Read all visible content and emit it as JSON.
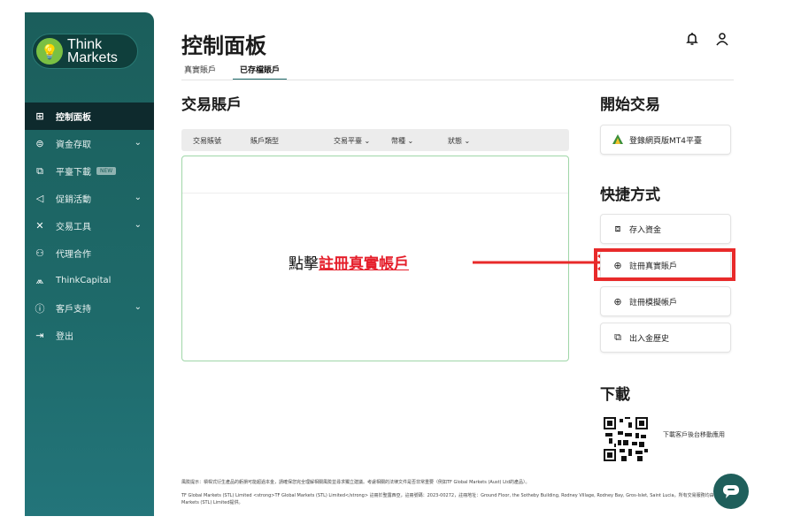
{
  "sidebar": {
    "logo": {
      "line1": "Think",
      "line2": "Markets"
    },
    "items": [
      {
        "label": "控制面板",
        "icon": "dashboard-icon",
        "active": true
      },
      {
        "label": "資金存取",
        "icon": "wallet-icon",
        "chevron": true
      },
      {
        "label": "平臺下載",
        "icon": "download-icon",
        "badge": "NEW"
      },
      {
        "label": "促銷活動",
        "icon": "megaphone-icon",
        "chevron": true
      },
      {
        "label": "交易工具",
        "icon": "tools-icon",
        "chevron": true
      },
      {
        "label": "代理合作",
        "icon": "partners-icon"
      },
      {
        "label": "ThinkCapital",
        "icon": "thinkcapital-icon"
      },
      {
        "label": "客戶支持",
        "icon": "info-icon",
        "chevron": true
      },
      {
        "label": "登出",
        "icon": "logout-icon"
      }
    ]
  },
  "header": {
    "title": "控制面板",
    "tabs": [
      {
        "label": "真實賬戶",
        "active": false
      },
      {
        "label": "已存檔賬戶",
        "active": true
      }
    ]
  },
  "accounts": {
    "title": "交易賬戶",
    "columns": [
      "交易賬號",
      "賬戶類型",
      "交易平臺 ⌄",
      "幣種 ⌄",
      "狀態 ⌄"
    ]
  },
  "annotation": {
    "prefix": "點擊",
    "link": "註冊真實帳戶"
  },
  "right": {
    "start_title": "開始交易",
    "mt4_button": "登錄網頁版MT4平臺",
    "shortcuts_title": "快捷方式",
    "shortcuts": [
      {
        "label": "存入資金",
        "icon": "deposit-icon"
      },
      {
        "label": "註冊真實賬戶",
        "icon": "plus-circle-icon"
      },
      {
        "label": "註冊模擬帳戶",
        "icon": "plus-circle-icon"
      },
      {
        "label": "出入金歷史",
        "icon": "history-icon"
      }
    ],
    "download_title": "下載",
    "download_text": "下載客戶後台移動應用"
  },
  "footer": {
    "line1": "風險提示：槓桿式衍生產品的虧損可能超過本金，請確保您完全理解相關風險並尋求獨立建議。考慮相關的法律文件是否非常重要（例如TF Global Markets (Aust) Ltd的產品）。",
    "line2": "TF Global Markets (STL) Limited <strong>TF Global Markets (STL) Limited</strong> 註冊於聖露西亞，註冊號碼：2023-00272，註冊地址：Ground Floor, the Sotheby Building, Rodney Village, Rodney Bay, Gros-Islet, Saint Lucia。所有交易服務均由TF Global Markets (STL) Limited提供。"
  },
  "colors": {
    "sidebar": "#1e6a6a",
    "active_nav": "#0e2a2d",
    "highlight": "#e82a2a",
    "annotation_link": "#e51f2b",
    "table_border": "#9fd6a8"
  }
}
